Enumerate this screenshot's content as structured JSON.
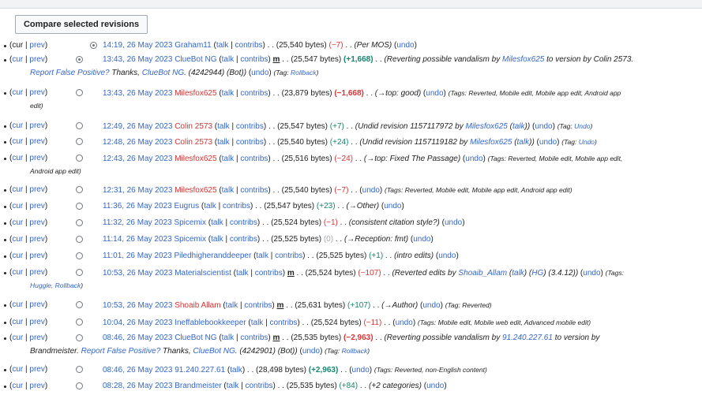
{
  "compare_button": "Compare selected revisions",
  "common": {
    "cur": "cur",
    "prev": "prev",
    "talk": "talk",
    "contribs": "contribs",
    "undo": "undo",
    "minor": "m"
  },
  "rows": [
    {
      "datetime": "14:19, 26 May 2023",
      "user": "Graham11",
      "bytes": "(25,540 bytes)",
      "diff": "(−7)",
      "comment": "(Per MOS)",
      "tags_label": "",
      "tags": ""
    },
    {
      "datetime": "13:43, 26 May 2023",
      "user": "ClueBot NG",
      "bytes": "(25,547 bytes)",
      "diff": "(+1,668)",
      "comment_a": "(Reverting possible vandalism by",
      "comment_user1": "Milesfox625",
      "comment_b": "to version by Colin 2573.",
      "report": "Report False Positive?",
      "thanks": "Thanks,",
      "comment_user2": "ClueBot NG",
      "comment_c": ". (4242944) (Bot))",
      "tags_label": "Tag:",
      "tags": "Rollback"
    },
    {
      "datetime": "13:43, 26 May 2023",
      "user": "Milesfox625",
      "bytes": "(23,879 bytes)",
      "diff": "(−1,668)",
      "comment": "(→top: good)",
      "tags_label": "Tags:",
      "tags_a": "Reverted, Mobile edit, Mobile app edit, Android app",
      "tags_b": "edit"
    },
    {
      "datetime": "12:49, 26 May 2023",
      "user": "Colin 2573",
      "bytes": "(25,547 bytes)",
      "diff": "(+7)",
      "comment_a": "(Undid revision 1157117972 by",
      "comment_user": "Milesfox625",
      "comment_talk": "talk",
      "comment_b": ")",
      "tags_label": "Tag:",
      "tags": "Undo"
    },
    {
      "datetime": "12:48, 26 May 2023",
      "user": "Colin 2573",
      "bytes": "(25,540 bytes)",
      "diff": "(+24)",
      "comment_a": "(Undid revision 1157119182 by",
      "comment_user": "Milesfox625",
      "comment_talk": "talk",
      "comment_b": ")",
      "tags_label": "Tag:",
      "tags": "Undo"
    },
    {
      "datetime": "12:43, 26 May 2023",
      "user": "Milesfox625",
      "bytes": "(25,516 bytes)",
      "diff": "(−24)",
      "comment": "(→top: Fixed The Passage)",
      "tags_label": "Tags:",
      "tags_a": "Reverted, Mobile edit, Mobile app edit,",
      "tags_b": "Android app edit"
    },
    {
      "datetime": "12:31, 26 May 2023",
      "user": "Milesfox625",
      "bytes": "(25,540 bytes)",
      "diff": "(−7)",
      "tags_label": "Tags:",
      "tags": "Reverted, Mobile edit, Mobile app edit, Android app edit"
    },
    {
      "datetime": "11:36, 26 May 2023",
      "user": "Eugrus",
      "bytes": "(25,547 bytes)",
      "diff": "(+23)",
      "comment": "(→Other)"
    },
    {
      "datetime": "11:32, 26 May 2023",
      "user": "Spicemix",
      "bytes": "(25,524 bytes)",
      "diff": "(−1)",
      "comment": "(consistent citation style?)"
    },
    {
      "datetime": "11:14, 26 May 2023",
      "user": "Spicemix",
      "bytes": "(25,525 bytes)",
      "diff": "(0)",
      "comment": "(→Reception: fmt)"
    },
    {
      "datetime": "11:01, 26 May 2023",
      "user": "Piledhigheranddeeper",
      "bytes": "(25,525 bytes)",
      "diff": "(+1)",
      "comment": "(intro edits)"
    },
    {
      "datetime": "10:53, 26 May 2023",
      "user": "Materialscientist",
      "bytes": "(25,524 bytes)",
      "diff": "(−107)",
      "comment_a": "(Reverted edits by",
      "comment_user": "Shoaib_Allam",
      "comment_talk": "talk",
      "comment_hg": "HG",
      "comment_b": "(3.4.12))",
      "tags_label": "Tags:",
      "tags_a": "",
      "tags_b": "Huggle, Rollback"
    },
    {
      "datetime": "10:53, 26 May 2023",
      "user": "Shoaib Allam",
      "bytes": "(25,631 bytes)",
      "diff": "(+107)",
      "comment": "(→Author)",
      "tags_label": "Tag:",
      "tags": "Reverted"
    },
    {
      "datetime": "10:04, 26 May 2023",
      "user": "Ineffablebookkeeper",
      "bytes": "(25,524 bytes)",
      "diff": "(−11)",
      "tags_label": "Tags:",
      "tags": "Mobile edit, Mobile web edit, Advanced mobile edit"
    },
    {
      "datetime": "08:46, 26 May 2023",
      "user": "ClueBot NG",
      "bytes": "(25,535 bytes)",
      "diff": "(−2,963)",
      "comment_a": "(Reverting possible vandalism by",
      "comment_user1": "91.240.227.61",
      "comment_b": "to version by",
      "comment_c": "Brandmeister.",
      "report": "Report False Positive?",
      "thanks": "Thanks,",
      "comment_user2": "ClueBot NG",
      "comment_d": ". (4242901) (Bot))",
      "tags_label": "Tag:",
      "tags": "Rollback"
    },
    {
      "datetime": "08:46, 26 May 2023",
      "user": "91.240.227.61",
      "bytes": "(28,498 bytes)",
      "diff": "(+2,963)",
      "tags_label": "Tags:",
      "tags": "Reverted, non-English content"
    },
    {
      "datetime": "08:28, 26 May 2023",
      "user": "Brandmeister",
      "bytes": "(25,535 bytes)",
      "diff": "(+84)",
      "comment": "(+2 categories)"
    }
  ]
}
